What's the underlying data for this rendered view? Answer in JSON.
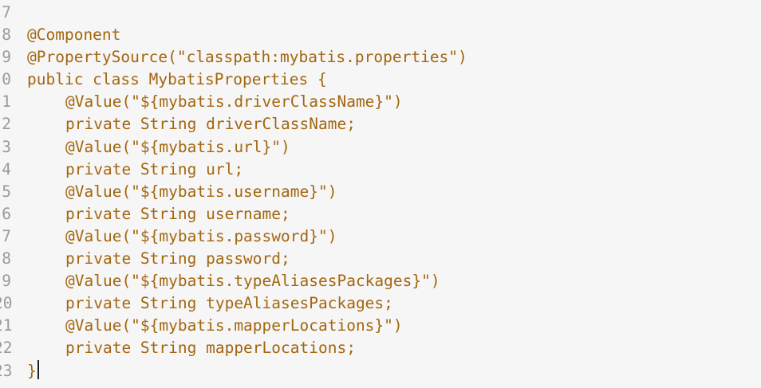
{
  "editor": {
    "line_numbers": [
      "7",
      "8",
      "9",
      "0",
      "1",
      "2",
      "3",
      "4",
      "5",
      "6",
      "7",
      "8",
      "9",
      "20",
      "21",
      "22",
      "23"
    ],
    "lines": [
      "",
      "@Component",
      "@PropertySource(\"classpath:mybatis.properties\")",
      "public class MybatisProperties {",
      "@Value(\"${mybatis.driverClassName}\")",
      "private String driverClassName;",
      "@Value(\"${mybatis.url}\")",
      "private String url;",
      "@Value(\"${mybatis.username}\")",
      "private String username;",
      "@Value(\"${mybatis.password}\")",
      "private String password;",
      "@Value(\"${mybatis.typeAliasesPackages}\")",
      "private String typeAliasesPackages;",
      "@Value(\"${mybatis.mapperLocations}\")",
      "private String mapperLocations;",
      "}"
    ],
    "colors": {
      "background": "#f6f6f6",
      "code_text": "#a3660f",
      "line_number": "#9a9a9a",
      "caret": "#222222"
    }
  }
}
